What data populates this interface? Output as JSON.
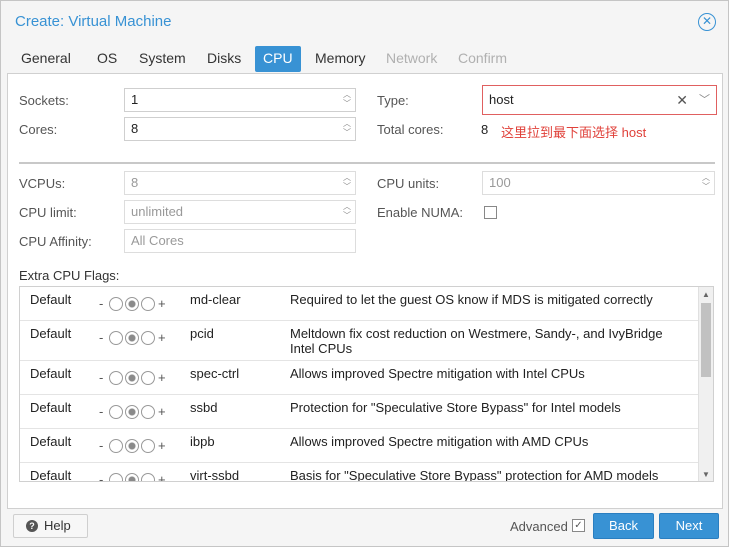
{
  "window": {
    "title": "Create: Virtual Machine",
    "close_icon": "close-icon"
  },
  "tabs": [
    {
      "label": "General",
      "state": "normal"
    },
    {
      "label": "OS",
      "state": "normal"
    },
    {
      "label": "System",
      "state": "normal"
    },
    {
      "label": "Disks",
      "state": "normal"
    },
    {
      "label": "CPU",
      "state": "active"
    },
    {
      "label": "Memory",
      "state": "normal"
    },
    {
      "label": "Network",
      "state": "disabled"
    },
    {
      "label": "Confirm",
      "state": "disabled"
    }
  ],
  "cpu": {
    "sockets_label": "Sockets:",
    "sockets_value": "1",
    "cores_label": "Cores:",
    "cores_value": "8",
    "type_label": "Type:",
    "type_value": "host",
    "total_cores_label": "Total cores:",
    "total_cores_value": "8",
    "annotation": "这里拉到最下面选择 host",
    "vcpus_label": "VCPUs:",
    "vcpus_value": "8",
    "cpu_units_label": "CPU units:",
    "cpu_units_value": "100",
    "cpu_limit_label": "CPU limit:",
    "cpu_limit_value": "unlimited",
    "enable_numa_label": "Enable NUMA:",
    "cpu_affinity_label": "CPU Affinity:",
    "cpu_affinity_placeholder": "All Cores",
    "extra_flags_label": "Extra CPU Flags:"
  },
  "flags": [
    {
      "state": "Default",
      "name": "md-clear",
      "desc": "Required to let the guest OS know if MDS is mitigated correctly"
    },
    {
      "state": "Default",
      "name": "pcid",
      "desc": "Meltdown fix cost reduction on Westmere, Sandy-, and IvyBridge Intel CPUs"
    },
    {
      "state": "Default",
      "name": "spec-ctrl",
      "desc": "Allows improved Spectre mitigation with Intel CPUs"
    },
    {
      "state": "Default",
      "name": "ssbd",
      "desc": "Protection for \"Speculative Store Bypass\" for Intel models"
    },
    {
      "state": "Default",
      "name": "ibpb",
      "desc": "Allows improved Spectre mitigation with AMD CPUs"
    },
    {
      "state": "Default",
      "name": "virt-ssbd",
      "desc": "Basis for \"Speculative Store Bypass\" protection for AMD models"
    }
  ],
  "tristate": {
    "minus": "-",
    "plus": "+"
  },
  "footer": {
    "help_label": "Help",
    "advanced_label": "Advanced",
    "back_label": "Back",
    "next_label": "Next"
  },
  "colors": {
    "accent": "#3892d4",
    "annotation": "#e0413a",
    "highlight_border": "#e06060"
  }
}
